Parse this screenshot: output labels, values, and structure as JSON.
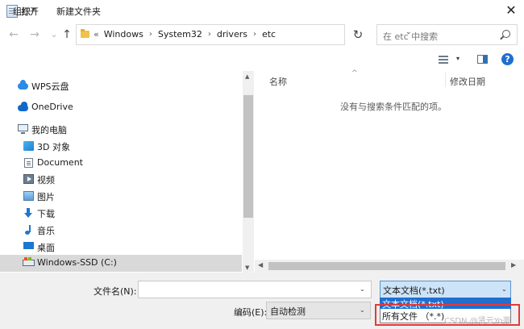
{
  "window": {
    "title": "打开",
    "close_glyph": "✕"
  },
  "nav": {
    "back_glyph": "←",
    "forward_glyph": "→",
    "history_glyph": "⌄",
    "up_glyph": "↑"
  },
  "address": {
    "overflow": "«",
    "crumbs": [
      "Windows",
      "System32",
      "drivers",
      "etc"
    ],
    "sep": "›",
    "dropdown_glyph": "⌄",
    "refresh_glyph": "↻"
  },
  "search": {
    "placeholder": "在 etc 中搜索"
  },
  "toolbar": {
    "organize": "组织",
    "caret": "▾",
    "new_folder": "新建文件夹",
    "help": "?"
  },
  "sidebar": {
    "items": [
      {
        "label": "WPS云盘",
        "icon": "cloud-icon"
      },
      {
        "label": "OneDrive",
        "icon": "onedrive-icon"
      },
      {
        "label": "我的电脑",
        "icon": "computer-icon"
      },
      {
        "label": "3D 对象",
        "icon": "3d-objects-icon"
      },
      {
        "label": "Document",
        "icon": "document-icon"
      },
      {
        "label": "视频",
        "icon": "video-icon"
      },
      {
        "label": "图片",
        "icon": "pictures-icon"
      },
      {
        "label": "下载",
        "icon": "download-icon"
      },
      {
        "label": "音乐",
        "icon": "music-icon"
      },
      {
        "label": "桌面",
        "icon": "desktop-icon"
      },
      {
        "label": "Windows-SSD (C:)",
        "icon": "drive-icon"
      }
    ],
    "scroll_up": "▲",
    "scroll_down": "▼",
    "scroll_left": "◀"
  },
  "filelist": {
    "col_name": "名称",
    "col_date": "修改日期",
    "sort_glyph": "^",
    "empty_message": "没有与搜索条件匹配的项。",
    "scroll_left": "◀",
    "scroll_right": "▶"
  },
  "footer": {
    "filename_label": "文件名(N):",
    "filename_value": "",
    "filetype_value": "文本文档(*.txt)",
    "encoding_label": "编码(E):",
    "encoding_value": "自动检测",
    "caret": "⌄",
    "dropdown_options": [
      "文本文档(*.txt)",
      "所有文件 （*.*)"
    ]
  },
  "watermark": "CSDN @贤云Yo豪",
  "colors": {
    "accent": "#1e6fd0",
    "highlight_box": "#e53935",
    "selected_row": "#d9d9d9"
  }
}
